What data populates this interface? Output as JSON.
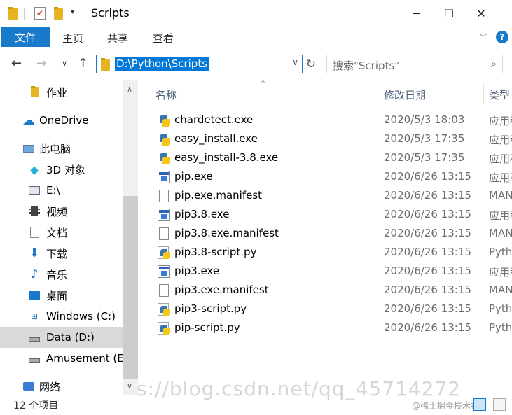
{
  "window": {
    "title": "Scripts",
    "minimize": "─",
    "maximize": "☐",
    "close": "✕"
  },
  "ribbon": {
    "file_tab": "文件",
    "tabs": [
      "主页",
      "共享",
      "查看"
    ],
    "help": "?"
  },
  "address": {
    "path": "D:\\Python\\Scripts",
    "search_placeholder": "搜索\"Scripts\""
  },
  "nav_pane": {
    "items": [
      {
        "label": "作业",
        "icon": "folder-icon"
      },
      {
        "label": "OneDrive",
        "icon": "cloud-icon"
      },
      {
        "label": "此电脑",
        "icon": "computer-icon"
      },
      {
        "label": "3D 对象",
        "icon": "3d-objects-icon"
      },
      {
        "label": "E:\\",
        "icon": "drive-icon"
      },
      {
        "label": "视频",
        "icon": "video-icon"
      },
      {
        "label": "文档",
        "icon": "document-icon"
      },
      {
        "label": "下载",
        "icon": "download-icon"
      },
      {
        "label": "音乐",
        "icon": "music-icon"
      },
      {
        "label": "桌面",
        "icon": "desktop-icon"
      },
      {
        "label": "Windows (C:)",
        "icon": "windows-drive-icon"
      },
      {
        "label": "Data (D:)",
        "icon": "drive-icon",
        "selected": true
      },
      {
        "label": "Amusement (E:",
        "icon": "drive-icon"
      },
      {
        "label": "网络",
        "icon": "network-icon"
      }
    ]
  },
  "file_list": {
    "columns": {
      "name": "名称",
      "date": "修改日期",
      "type": "类型"
    },
    "files": [
      {
        "name": "chardetect.exe",
        "date": "2020/5/3 18:03",
        "type": "应用程",
        "kind": "pyexe"
      },
      {
        "name": "easy_install.exe",
        "date": "2020/5/3 17:35",
        "type": "应用程",
        "kind": "pyexe"
      },
      {
        "name": "easy_install-3.8.exe",
        "date": "2020/5/3 17:35",
        "type": "应用程",
        "kind": "pyexe"
      },
      {
        "name": "pip.exe",
        "date": "2020/6/26 13:15",
        "type": "应用程",
        "kind": "exe"
      },
      {
        "name": "pip.exe.manifest",
        "date": "2020/6/26 13:15",
        "type": "MAN",
        "kind": "manifest"
      },
      {
        "name": "pip3.8.exe",
        "date": "2020/6/26 13:15",
        "type": "应用程",
        "kind": "exe"
      },
      {
        "name": "pip3.8.exe.manifest",
        "date": "2020/6/26 13:15",
        "type": "MAN",
        "kind": "manifest"
      },
      {
        "name": "pip3.8-script.py",
        "date": "2020/6/26 13:15",
        "type": "Pytho",
        "kind": "py"
      },
      {
        "name": "pip3.exe",
        "date": "2020/6/26 13:15",
        "type": "应用程",
        "kind": "exe"
      },
      {
        "name": "pip3.exe.manifest",
        "date": "2020/6/26 13:15",
        "type": "MAN",
        "kind": "manifest"
      },
      {
        "name": "pip3-script.py",
        "date": "2020/6/26 13:15",
        "type": "Pytho",
        "kind": "py"
      },
      {
        "name": "pip-script.py",
        "date": "2020/6/26 13:15",
        "type": "Pytho",
        "kind": "py"
      }
    ]
  },
  "status": {
    "count": "12 个项目",
    "watermark": "s://blog.csdn.net/qq_45714272",
    "watermark_small": "@稀土掘金技术社区"
  },
  "colors": {
    "accent": "#1979ca",
    "selection": "#0078d7",
    "nav_selected": "#d9d9d9"
  }
}
